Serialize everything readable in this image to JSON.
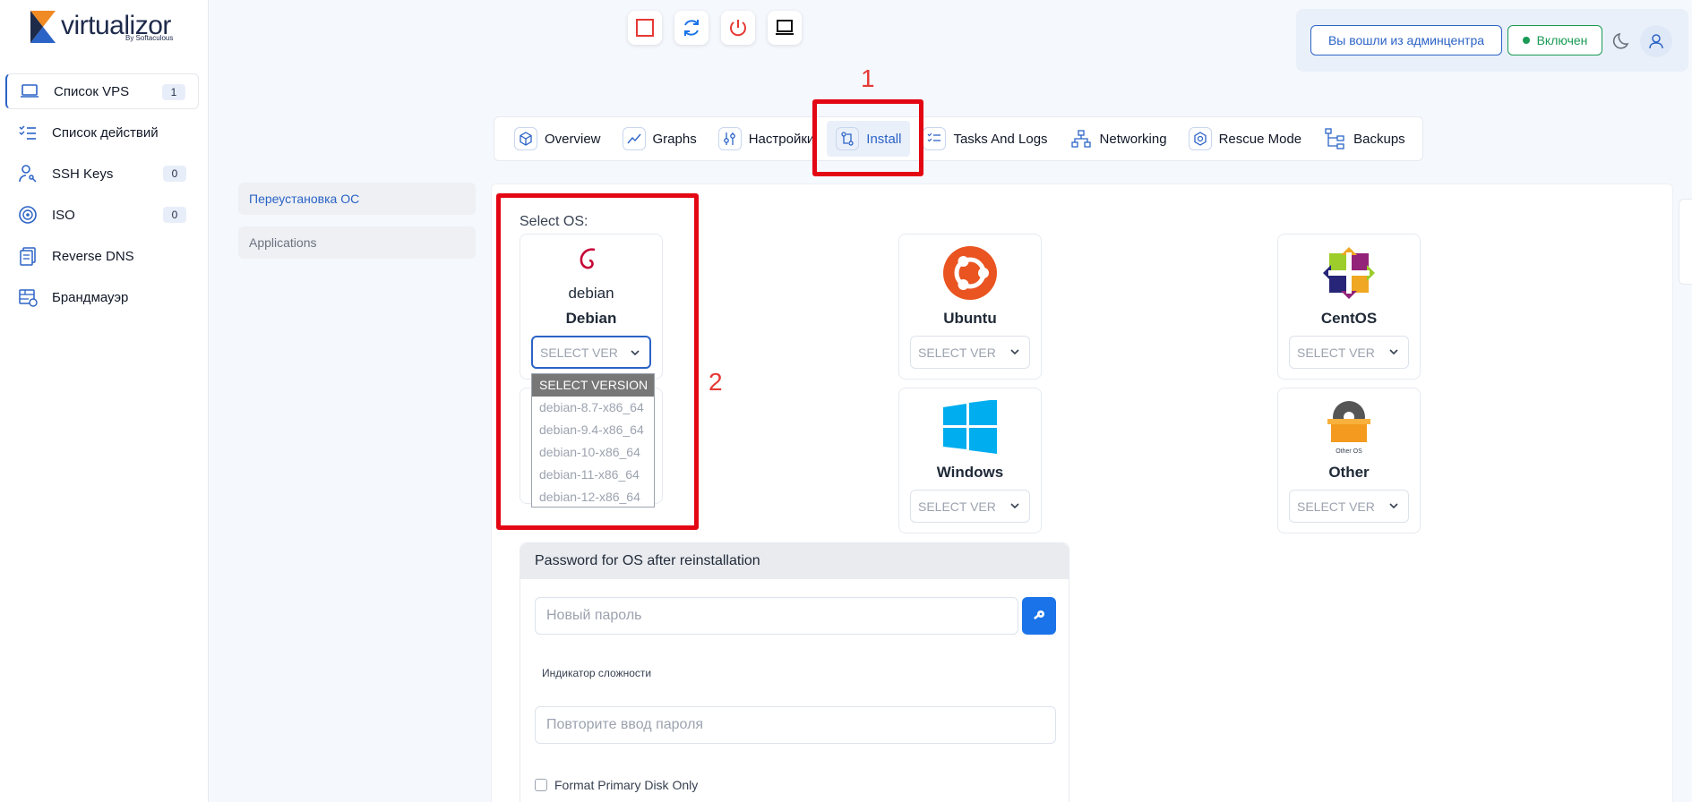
{
  "brand": {
    "name": "virtualizor",
    "sub": "By Softaculous"
  },
  "sidebar": {
    "items": [
      {
        "label": "Список VPS",
        "badge": "1",
        "icon": "laptop-icon"
      },
      {
        "label": "Список действий",
        "badge": "",
        "icon": "checklist-icon"
      },
      {
        "label": "SSH Keys",
        "badge": "0",
        "icon": "user-key-icon"
      },
      {
        "label": "ISO",
        "badge": "0",
        "icon": "disc-icon"
      },
      {
        "label": "Reverse DNS",
        "badge": "",
        "icon": "dns-docs-icon"
      },
      {
        "label": "Брандмауэр",
        "badge": "",
        "icon": "firewall-icon"
      }
    ]
  },
  "toolbar": {
    "icons": [
      "stop-icon",
      "restart-icon",
      "power-icon",
      "console-icon"
    ]
  },
  "header": {
    "admin_label": "Вы вошли из админцентра",
    "status_label": "Включен"
  },
  "annotations": {
    "label_1": "1",
    "label_2": "2"
  },
  "tabs": [
    {
      "label": "Overview",
      "icon": "cube-icon"
    },
    {
      "label": "Graphs",
      "icon": "line-chart-icon"
    },
    {
      "label": "Настройки",
      "icon": "sliders-icon"
    },
    {
      "label": "Install",
      "icon": "git-compare-icon",
      "active": true
    },
    {
      "label": "Tasks And Logs",
      "icon": "task-list-icon"
    },
    {
      "label": "Networking",
      "icon": "network-icon"
    },
    {
      "label": "Rescue Mode",
      "icon": "rescue-box-icon"
    },
    {
      "label": "Backups",
      "icon": "backup-tree-icon"
    }
  ],
  "submenu": [
    {
      "label": "Переустановка ОС",
      "active": true
    },
    {
      "label": "Applications",
      "active": false
    }
  ],
  "install": {
    "select_os_label": "Select OS:",
    "os": [
      {
        "name": "Debian",
        "select": "SELECT VER",
        "icon": "debian-logo-icon",
        "logo_text": "debian"
      },
      {
        "name": "Ubuntu",
        "select": "SELECT VER",
        "icon": "ubuntu-logo-icon"
      },
      {
        "name": "CentOS",
        "select": "SELECT VER",
        "icon": "centos-logo-icon"
      },
      {
        "name": "Windows",
        "select": "SELECT VER",
        "icon": "windows-logo-icon"
      },
      {
        "name": "Other",
        "select": "SELECT VER",
        "icon": "other-os-icon",
        "logo_text": "Other OS"
      }
    ],
    "debian_options": [
      "SELECT VERSION",
      "debian-8.7-x86_64",
      "debian-9.4-x86_64",
      "debian-10-x86_64",
      "debian-11-x86_64",
      "debian-12-x86_64"
    ]
  },
  "password": {
    "heading": "Password for OS after reinstallation",
    "new_placeholder": "Новый пароль",
    "meter_label": "Индикатор сложности",
    "repeat_placeholder": "Повторите ввод пароля",
    "format_label": "Format Primary Disk Only"
  },
  "colors": {
    "accent": "#2b63c6",
    "success": "#1a9a55",
    "annotation": "#e30613"
  }
}
